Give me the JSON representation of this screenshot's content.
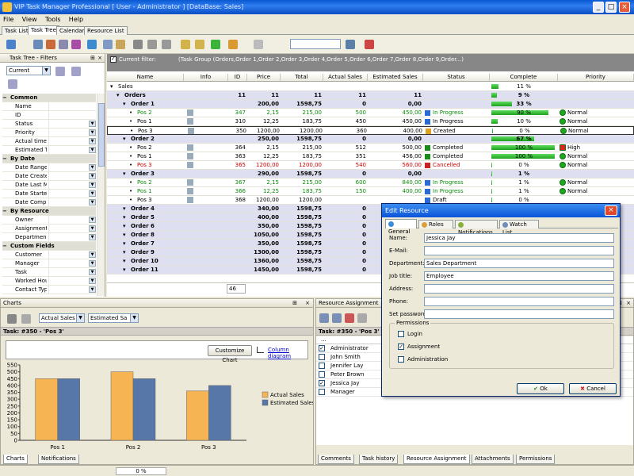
{
  "window": {
    "title": "VIP Task Manager Professional [ User - Administrator ] [DataBase: Sales]"
  },
  "menu": [
    "File",
    "View",
    "Tools",
    "Help"
  ],
  "tabs": [
    "Task List",
    "Task Tree",
    "Calendar",
    "Resource List"
  ],
  "filters_panel": {
    "title": "Task Tree - Filters",
    "current": "Current",
    "rows": [
      {
        "label": "Common",
        "cat": true
      },
      {
        "label": "Name"
      },
      {
        "label": "ID"
      },
      {
        "label": "Status",
        "dd": true
      },
      {
        "label": "Priority",
        "dd": true
      },
      {
        "label": "Actual time",
        "dd": true
      },
      {
        "label": "Estimated Ti",
        "dd": true
      },
      {
        "label": "By Date",
        "cat": true
      },
      {
        "label": "Date Range",
        "dd": true
      },
      {
        "label": "Date Create",
        "dd": true
      },
      {
        "label": "Date Last M",
        "dd": true
      },
      {
        "label": "Date Startec",
        "dd": true
      },
      {
        "label": "Date Compl",
        "dd": true
      },
      {
        "label": "By Resource",
        "cat": true
      },
      {
        "label": "Owner",
        "dd": true
      },
      {
        "label": "Assignment",
        "dd": true
      },
      {
        "label": "Department",
        "dd": true
      },
      {
        "label": "Custom Fields",
        "cat": true
      },
      {
        "label": "Customer",
        "dd": true
      },
      {
        "label": "Manager",
        "dd": true
      },
      {
        "label": "Task",
        "dd": true
      },
      {
        "label": "Worked Hou",
        "dd": true
      },
      {
        "label": "Contact Typ",
        "dd": true
      }
    ]
  },
  "grid": {
    "filter_label": "Current filter:",
    "filter_text": "(Task Group (Orders,Order 1,Order 2,Order 3,Order 4,Order 5,Order 6,Order 7,Order 8,Order 9,Order...)",
    "columns": [
      "Name",
      "Info",
      "ID",
      "Price",
      "Total",
      "Actual Sales",
      "Estimated Sales",
      "Status",
      "Complete",
      "Priority"
    ],
    "footer_value": "46",
    "rows": [
      {
        "indent": 0,
        "name": "Sales",
        "group": false,
        "id": "",
        "price": "",
        "total": "",
        "actual": "",
        "est": "",
        "status": "",
        "complete": "11 %",
        "pct": 11,
        "priority": ""
      },
      {
        "indent": 1,
        "name": "Orders",
        "group": true,
        "id": "11",
        "price": "11",
        "total": "11",
        "actual": "11",
        "est": "11",
        "status": "",
        "complete": "9 %",
        "pct": 9,
        "priority": ""
      },
      {
        "indent": 2,
        "name": "Order 1",
        "group": true,
        "id": "",
        "price": "200,00",
        "total": "1598,75",
        "actual": "0",
        "est": "0,00",
        "status": "",
        "complete": "33 %",
        "pct": 33,
        "priority": ""
      },
      {
        "indent": 3,
        "name": "Pos 2",
        "color": "green",
        "id": "347",
        "price": "2,15",
        "total": "215,00",
        "actual": "500",
        "est": "450,00",
        "status": "In Progress",
        "complete": "90 %",
        "pct": 90,
        "priority": "Normal"
      },
      {
        "indent": 3,
        "name": "Pos 1",
        "id": "310",
        "price": "12,25",
        "total": "183,75",
        "actual": "450",
        "est": "450,00",
        "status": "In Progress",
        "complete": "10 %",
        "pct": 10,
        "priority": "Normal"
      },
      {
        "indent": 3,
        "name": "Pos 3",
        "selected": true,
        "id": "350",
        "price": "1200,00",
        "total": "1200,00",
        "actual": "360",
        "est": "400,00",
        "status": "Created",
        "complete": "0 %",
        "pct": 0,
        "priority": "Normal"
      },
      {
        "indent": 2,
        "name": "Order 2",
        "group": true,
        "id": "",
        "price": "250,00",
        "total": "1598,75",
        "actual": "0",
        "est": "0,00",
        "status": "",
        "complete": "67 %",
        "pct": 67,
        "priority": ""
      },
      {
        "indent": 3,
        "name": "Pos 2",
        "id": "364",
        "price": "2,15",
        "total": "215,00",
        "actual": "512",
        "est": "500,00",
        "status": "Completed",
        "complete": "100 %",
        "pct": 100,
        "priority": "High"
      },
      {
        "indent": 3,
        "name": "Pos 1",
        "id": "363",
        "price": "12,25",
        "total": "183,75",
        "actual": "351",
        "est": "456,00",
        "status": "Completed",
        "complete": "100 %",
        "pct": 100,
        "priority": "Normal"
      },
      {
        "indent": 3,
        "name": "Pos 3",
        "color": "red",
        "id": "365",
        "price": "1200,00",
        "total": "1200,00",
        "actual": "540",
        "est": "560,00",
        "status": "Cancelled",
        "complete": "0 %",
        "pct": 0,
        "priority": "Normal"
      },
      {
        "indent": 2,
        "name": "Order 3",
        "group": true,
        "id": "",
        "price": "290,00",
        "total": "1598,75",
        "actual": "0",
        "est": "0,00",
        "status": "",
        "complete": "1 %",
        "pct": 1,
        "priority": ""
      },
      {
        "indent": 3,
        "name": "Pos 2",
        "color": "green",
        "id": "367",
        "price": "2,15",
        "total": "215,00",
        "actual": "600",
        "est": "840,00",
        "status": "In Progress",
        "complete": "1 %",
        "pct": 1,
        "priority": "Normal"
      },
      {
        "indent": 3,
        "name": "Pos 1",
        "color": "green",
        "id": "366",
        "price": "12,25",
        "total": "183,75",
        "actual": "150",
        "est": "400,00",
        "status": "In Progress",
        "complete": "1 %",
        "pct": 1,
        "priority": "Normal"
      },
      {
        "indent": 3,
        "name": "Pos 3",
        "id": "368",
        "price": "1200,00",
        "total": "1200,00",
        "actual": "",
        "est": "",
        "status": "Draft",
        "complete": "0 %",
        "pct": 0,
        "priority": ""
      },
      {
        "indent": 2,
        "name": "Order 4",
        "group": true,
        "id": "",
        "price": "340,00",
        "total": "1598,75",
        "actual": "0",
        "est": "",
        "status": "",
        "complete": "",
        "pct": 0,
        "priority": ""
      },
      {
        "indent": 2,
        "name": "Order 5",
        "group": true,
        "id": "",
        "price": "400,00",
        "total": "1598,75",
        "actual": "0",
        "est": "",
        "status": "",
        "complete": "",
        "pct": 0,
        "priority": ""
      },
      {
        "indent": 2,
        "name": "Order 6",
        "group": true,
        "id": "",
        "price": "350,00",
        "total": "1598,75",
        "actual": "0",
        "est": "",
        "status": "",
        "complete": "",
        "pct": 0,
        "priority": ""
      },
      {
        "indent": 2,
        "name": "Order 8",
        "group": true,
        "id": "",
        "price": "1050,00",
        "total": "1598,75",
        "actual": "0",
        "est": "",
        "status": "",
        "complete": "",
        "pct": 0,
        "priority": ""
      },
      {
        "indent": 2,
        "name": "Order 7",
        "group": true,
        "id": "",
        "price": "350,00",
        "total": "1598,75",
        "actual": "0",
        "est": "",
        "status": "",
        "complete": "",
        "pct": 0,
        "priority": ""
      },
      {
        "indent": 2,
        "name": "Order 9",
        "group": true,
        "id": "",
        "price": "1300,00",
        "total": "1598,75",
        "actual": "0",
        "est": "",
        "status": "",
        "complete": "",
        "pct": 0,
        "priority": ""
      },
      {
        "indent": 2,
        "name": "Order 10",
        "group": true,
        "id": "",
        "price": "1360,00",
        "total": "1598,75",
        "actual": "0",
        "est": "",
        "status": "",
        "complete": "",
        "pct": 0,
        "priority": ""
      },
      {
        "indent": 2,
        "name": "Order 11",
        "group": true,
        "id": "",
        "price": "1450,00",
        "total": "1598,75",
        "actual": "0",
        "est": "",
        "status": "",
        "complete": "",
        "pct": 0,
        "priority": ""
      }
    ]
  },
  "charts_panel": {
    "title": "Charts",
    "sel1": "Actual Sales",
    "sel2": "Estimated Sa",
    "task_label": "Task: #350 - 'Pos 3'",
    "customize": "Customize Chart",
    "column_diagram": "Column diagram",
    "tabs": [
      "Charts",
      "Notifications"
    ]
  },
  "chart_data": {
    "type": "bar",
    "categories": [
      "Pos 1",
      "Pos 2",
      "Pos 3"
    ],
    "series": [
      {
        "name": "Actual Sales",
        "values": [
          450,
          500,
          360
        ],
        "color": "#f6b453"
      },
      {
        "name": "Estimated Sales",
        "values": [
          450,
          450,
          400
        ],
        "color": "#5777a8"
      }
    ],
    "ylim": [
      0,
      550
    ],
    "yticks": [
      0,
      50,
      100,
      150,
      200,
      250,
      300,
      350,
      400,
      450,
      500,
      550
    ],
    "legend": "right",
    "grid": false
  },
  "resource_panel": {
    "title": "Resource Assignment",
    "task_label": "Task: #350 - 'Pos 3'",
    "col": "...",
    "people": [
      {
        "name": "Administrator",
        "checked": true
      },
      {
        "name": "John Smith",
        "checked": false
      },
      {
        "name": "Jennifer Lay",
        "checked": false
      },
      {
        "name": "Peter Brown",
        "checked": false
      },
      {
        "name": "Jessica Jay",
        "checked": true
      },
      {
        "name": "Manager",
        "checked": false
      }
    ],
    "tabs": [
      "Comments",
      "Task history",
      "Resource Assignment",
      "Attachments",
      "Permissions"
    ]
  },
  "dialog": {
    "title": "Edit Resource",
    "tabs": [
      "General",
      "Roles",
      "Notifications",
      "Watch List"
    ],
    "fields": [
      {
        "label": "Name:",
        "value": "Jessica Jay"
      },
      {
        "label": "E-Mail:",
        "value": ""
      },
      {
        "label": "Department:",
        "value": "Sales Department"
      },
      {
        "label": "Job title:",
        "value": "Employee"
      },
      {
        "label": "Address:",
        "value": ""
      },
      {
        "label": "Phone:",
        "value": ""
      },
      {
        "label": "Set password:",
        "value": ""
      }
    ],
    "permissions_label": "Permissions",
    "permissions": [
      {
        "label": "Login",
        "checked": false
      },
      {
        "label": "Assignment",
        "checked": true
      },
      {
        "label": "Administration",
        "checked": false
      }
    ],
    "ok": "Ok",
    "cancel": "Cancel"
  },
  "status": {
    "progress": "0 %"
  }
}
